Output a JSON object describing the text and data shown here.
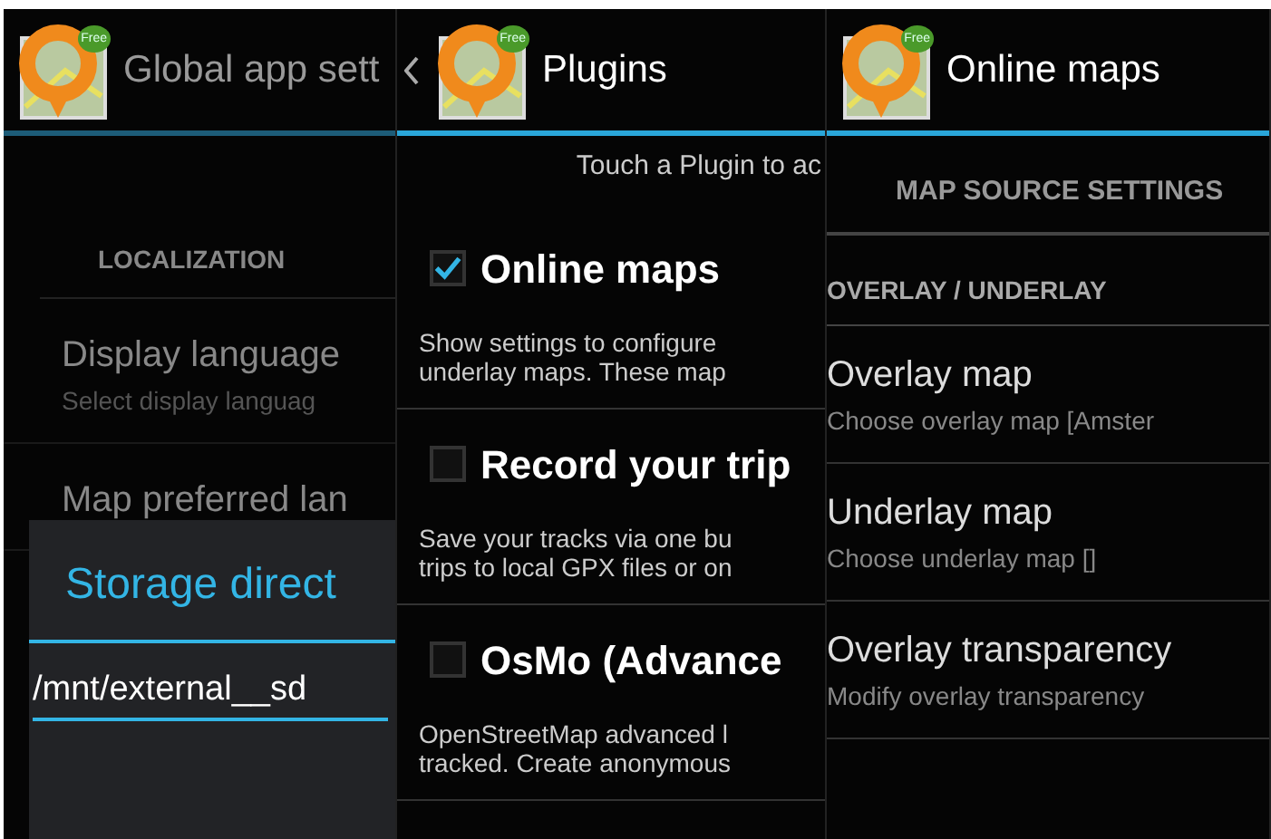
{
  "panels": [
    {
      "kind": "settings",
      "title": "Global app sett",
      "badge": "Free",
      "section": "LOCALIZATION",
      "items": [
        {
          "title": "Display language",
          "summary": "Select display languag"
        },
        {
          "title": "Map preferred lan"
        }
      ],
      "dialog": {
        "title": "Storage direct",
        "value": "/mnt/external__sd"
      }
    },
    {
      "kind": "plugins",
      "title": "Plugins",
      "badge": "Free",
      "hint": "Touch a Plugin to ac",
      "plugins": [
        {
          "name": "Online maps",
          "checked": true,
          "description": "Show settings to configure\nunderlay maps. These map"
        },
        {
          "name": "Record your trip",
          "checked": false,
          "description": "Save your tracks via one bu\ntrips to local GPX files or on"
        },
        {
          "name": "OsMo (Advance",
          "checked": false,
          "description": "OpenStreetMap advanced l\ntracked. Create anonymous"
        }
      ]
    },
    {
      "kind": "plugin_settings",
      "title": "Online maps",
      "badge": "Free",
      "tab": "MAP SOURCE SETTINGS",
      "section": "OVERLAY / UNDERLAY",
      "items": [
        {
          "title": "Overlay map",
          "summary": "Choose overlay map  [Amster"
        },
        {
          "title": "Underlay map",
          "summary": "Choose underlay map []"
        },
        {
          "title": "Overlay transparency",
          "summary": "Modify overlay transparency"
        }
      ]
    }
  ]
}
